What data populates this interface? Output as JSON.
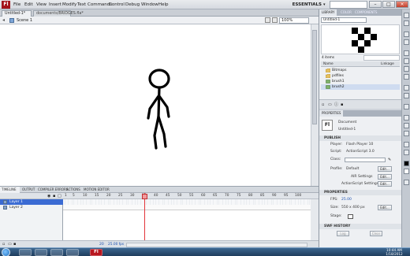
{
  "app": {
    "logo": "Fl",
    "workspace": "ESSENTIALS",
    "window_controls": {
      "minimize": "–",
      "maximize": "□",
      "close": "×"
    }
  },
  "menus": [
    "File",
    "Edit",
    "View",
    "Insert",
    "Modify",
    "Text",
    "Commands",
    "Control",
    "Debug",
    "Window",
    "Help"
  ],
  "doc_tabs": [
    "Untitled-1*",
    "documents/BRIDGES.fla*"
  ],
  "edit_bar": {
    "scene": "Scene 1",
    "zoom": "100%"
  },
  "timeline": {
    "tabs": [
      "TIMELINE",
      "OUTPUT",
      "COMPILER ERRORS",
      "ACTIONS",
      "MOTION EDITOR"
    ],
    "ticks": [
      "1",
      "5",
      "10",
      "15",
      "20",
      "25",
      "30",
      "35",
      "40",
      "45",
      "50",
      "55",
      "60",
      "65",
      "70",
      "75",
      "80",
      "85",
      "90",
      "95",
      "100"
    ],
    "layers": [
      {
        "name": "Layer 1",
        "selected": true
      },
      {
        "name": "Layer 2",
        "selected": false
      }
    ],
    "current_frame": "20",
    "fps": "25.00 fps"
  },
  "library": {
    "tabs": [
      "LIBRARY",
      "COLOR",
      "COMPONENTS"
    ],
    "document": "Untitled-1",
    "count": "4 items",
    "columns": {
      "name": "Name",
      "linkage": "Linkage"
    },
    "items": [
      {
        "name": "Bitmaps",
        "icon": "folder-icon"
      },
      {
        "name": "pdfiles",
        "icon": "folder-icon"
      },
      {
        "name": "brush1",
        "icon": "symbol-icon"
      },
      {
        "name": "brush2",
        "icon": "symbol-icon",
        "selected": true
      }
    ]
  },
  "properties": {
    "tab": "PROPERTIES",
    "doc_icon": "Fl",
    "doc_type": "Document",
    "doc_name": "Untitled-1",
    "publish_header": "PUBLISH",
    "player_label": "Player:",
    "player_value": "Flash Player 10",
    "script_label": "Script:",
    "script_value": "ActionScript 3.0",
    "class_label": "Class:",
    "profile_label": "Profile:",
    "profile_value": "Default",
    "edit_label": "Edit...",
    "air_settings": "AIR Settings",
    "as_settings": "ActionScript Settings",
    "props_header": "PROPERTIES",
    "fps_label": "FPS:",
    "fps_value": "25.00",
    "size_label": "Size:",
    "size_value": "550 x 400 px",
    "stage_label": "Stage:",
    "swf_header": "SWF HISTORY",
    "log_btn": "Log",
    "clear_btn": "Clear"
  },
  "taskbar": {
    "flash_label": "Fl",
    "time": "10:44 AM",
    "date": "1/18/2012"
  },
  "colors": {
    "accent": "#3b6bd3",
    "playhead": "#e3353a",
    "flash_red": "#b8161f"
  }
}
